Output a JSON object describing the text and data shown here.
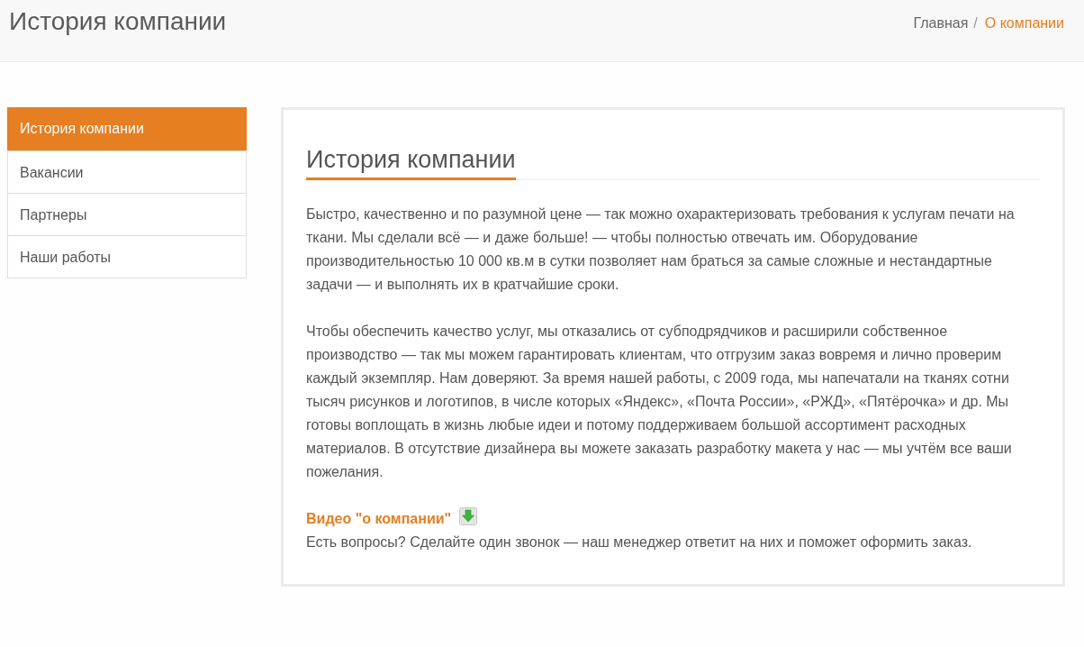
{
  "header": {
    "title": "История компании",
    "breadcrumb": {
      "separator": "/",
      "items": [
        {
          "label": "Главная",
          "current": false
        },
        {
          "label": "О компании",
          "current": true
        }
      ]
    }
  },
  "sidebar": {
    "items": [
      {
        "label": "История компании",
        "selected": true
      },
      {
        "label": "Вакансии",
        "selected": false
      },
      {
        "label": "Партнеры",
        "selected": false
      },
      {
        "label": "Наши работы",
        "selected": false
      }
    ]
  },
  "content": {
    "title": "История компании",
    "paragraphs": [
      "Быстро, качественно и по разумной цене — так можно охарактеризовать требования к услугам печати на ткани. Мы сделали всё — и даже больше! — чтобы полностью отвечать им. Оборудование производительностью 10 000 кв.м в сутки позволяет нам браться за самые сложные и нестандартные задачи — и выполнять их в кратчайшие сроки.",
      "Чтобы обеспечить качество услуг, мы отказались от субподрядчиков и расширили собственное производство — так мы можем гарантировать клиентам, что отгрузим заказ вовремя и лично проверим каждый экземпляр. Нам доверяют. За время нашей работы, с 2009 года, мы напечатали на тканях сотни тысяч рисунков и логотипов, в числе которых «Яндекс», «Почта России», «РЖД», «Пятёрочка» и др. Мы готовы воплощать в жизнь любые идеи и потому поддерживаем большой ассортимент расходных материалов. В отсутствие дизайнера вы можете заказать разработку макета у нас — мы учтём все ваши пожелания."
    ],
    "video_link": "Видео \"о компании\"",
    "note": "Есть вопросы? Сделайте один звонок — наш менеджер ответит на них и поможет оформить заказ."
  }
}
